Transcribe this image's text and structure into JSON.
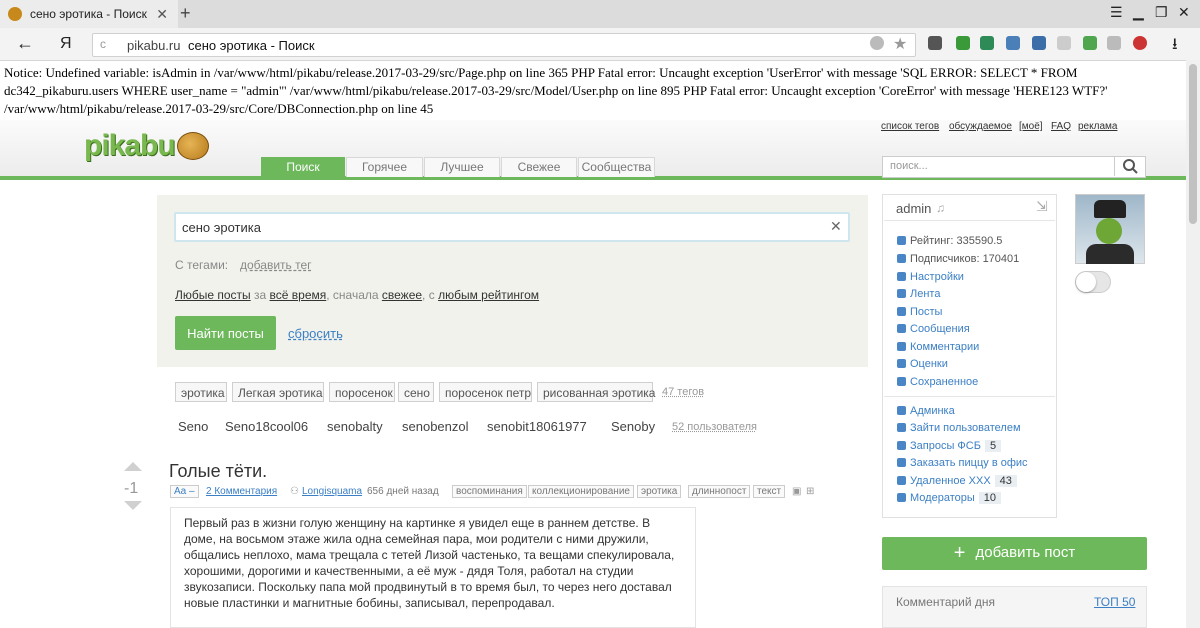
{
  "browser": {
    "tab_title": "сено эротика - Поиск",
    "new_tab": "+",
    "yandex_button": "Я",
    "url_host": "pikabu.ru",
    "url_title": "сено эротика - Поиск"
  },
  "notice": "Notice: Undefined variable: isAdmin in /var/www/html/pikabu/release.2017-03-29/src/Page.php on line 365 PHP Fatal error: Uncaught exception 'UserError' with message 'SQL ERROR: SELECT * FROM dc342_pikaburu.users WHERE user_name = \"admin\"' /var/www/html/pikabu/release.2017-03-29/src/Model/User.php on line 895 PHP Fatal error: Uncaught exception 'CoreError' with message 'HERE123 WTF?' /var/www/html/pikabu/release.2017-03-29/src/Core/DBConnection.php on line 45",
  "site": {
    "logo": "pikabu",
    "top_links": [
      "список тегов",
      "обсуждаемое",
      "[моё]",
      "FAQ",
      "реклама"
    ],
    "nav_tabs": [
      "Поиск",
      "Горячее",
      "Лучшее",
      "Свежее",
      "Сообщества"
    ],
    "search_placeholder": "поиск..."
  },
  "search": {
    "query": "сено эротика",
    "tags_label": "С тегами:",
    "add_tag": "добавить тег",
    "f_any": "Любые посты",
    "f_for": " за ",
    "f_time": "всё время",
    "f_first": ", сначала ",
    "f_fresh": "свежее",
    "f_with": ", с ",
    "f_rating": "любым рейтингом",
    "find_button": "Найти посты",
    "reset": "сбросить"
  },
  "tags": [
    "эротика",
    "Легкая эротика",
    "поросенок",
    "сено",
    "поросенок петр",
    "рисованная эротика"
  ],
  "tags_count": "47 тегов",
  "users": [
    "Seno",
    "Seno18cool06",
    "senobalty",
    "senobenzol",
    "senobit18061977",
    "Senoby"
  ],
  "users_count": "52 пользователя",
  "post": {
    "rating": "-1",
    "title": "Голые тёти.",
    "aa": "Aa –",
    "comments": "2 Комментария",
    "author": "Longisquama",
    "age": "656 дней назад",
    "tags": [
      "воспоминания",
      "коллекционирование",
      "эротика",
      "длиннопост",
      "текст"
    ],
    "text": "Первый раз в жизни голую женщину на картинке я увидел еще в раннем детстве. В доме, на восьмом этаже жила одна семейная пара, мои родители с ними дружили, общались неплохо, мама трещала с тетей Лизой частенько, та вещами спекулировала, хорошими, дорогими и качественными, а её муж - дядя Толя, работал на студии звукозаписи. Поскольку папа мой продвинутый в то время был, то через него доставал новые пластинки и магнитные бобины, записывал, перепродавал."
  },
  "profile": {
    "name": "admin",
    "rating": "Рейтинг: 335590.5",
    "subscribers": "Подписчиков: 170401",
    "menu": [
      "Настройки",
      "Лента",
      "Посты",
      "Сообщения",
      "Комментарии",
      "Оценки",
      "Сохраненное"
    ],
    "admin_menu": [
      {
        "label": "Админка",
        "badge": ""
      },
      {
        "label": "Зайти пользователем",
        "badge": ""
      },
      {
        "label": "Запросы ФСБ",
        "badge": "5"
      },
      {
        "label": "Заказать пиццу в офис",
        "badge": ""
      },
      {
        "label": "Удаленное XXX",
        "badge": "43"
      },
      {
        "label": "Модераторы",
        "badge": "10"
      }
    ]
  },
  "add_post": "добавить пост",
  "comment_day": {
    "title": "Комментарий дня",
    "top": "ТОП 50"
  }
}
